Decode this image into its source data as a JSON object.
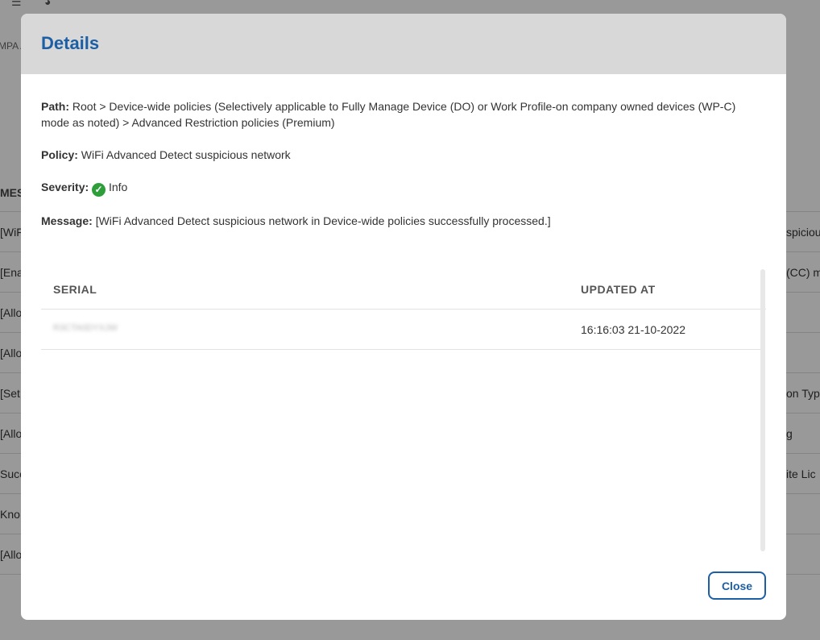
{
  "background": {
    "breadcrumb_fragment": "MPA A",
    "table_header": "MES",
    "rows": [
      {
        "left": "[WiF",
        "right": "spiciou"
      },
      {
        "left": "[Ena",
        "right": "(CC) m"
      },
      {
        "left": "[Allo",
        "right": ""
      },
      {
        "left": "[Allo",
        "right": ""
      },
      {
        "left": "[Set",
        "right": "on Typ"
      },
      {
        "left": "[Allo",
        "right": "g"
      },
      {
        "left": "Succ",
        "right": "ite Lic"
      },
      {
        "left": "Kno",
        "right": ""
      },
      {
        "left": "[Allo",
        "right": ""
      }
    ]
  },
  "modal": {
    "title": "Details",
    "path_label": "Path:",
    "path_value": "Root > Device-wide policies (Selectively applicable to Fully Manage Device (DO) or Work Profile-on company owned devices (WP-C) mode as noted) > Advanced Restriction policies (Premium)",
    "policy_label": "Policy:",
    "policy_value": "WiFi Advanced Detect suspicious network",
    "severity_label": "Severity:",
    "severity_value": "Info",
    "message_label": "Message:",
    "message_value": "[WiFi Advanced Detect suspicious network in Device-wide policies successfully processed.]",
    "table": {
      "headers": [
        "SERIAL",
        "UPDATED AT"
      ],
      "rows": [
        {
          "serial": "R3CTA0DYXJW",
          "updated_at": "16:16:03 21-10-2022"
        }
      ]
    },
    "close_label": "Close"
  },
  "colors": {
    "accent": "#1d5fa5",
    "success": "#2e9e3a",
    "header_bg": "#d8d8d8"
  }
}
